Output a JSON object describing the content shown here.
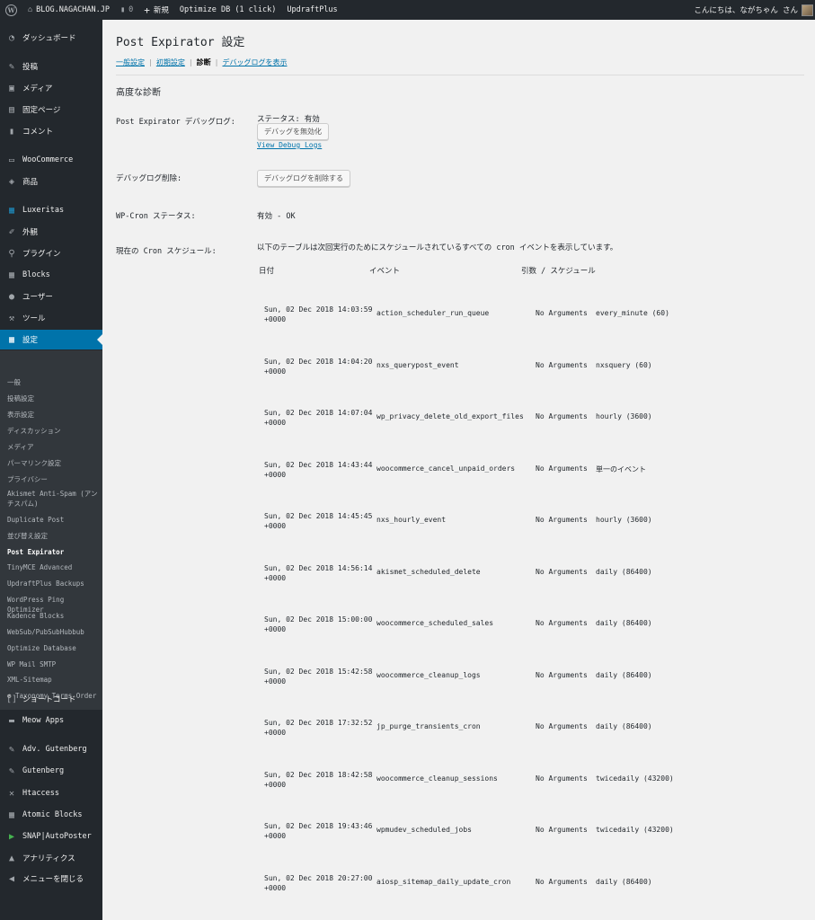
{
  "adminbar": {
    "site_name": "BLOG.NAGACHAN.JP",
    "comments_count": "0",
    "new_label": "新規",
    "optimize_label": "Optimize DB (1 click)",
    "updraft_label": "UpdraftPlus",
    "greeting": "こんにちは、ながちゃん さん"
  },
  "sidebar": {
    "items": [
      {
        "label": "ダッシュボード",
        "icon": "dashboard-icon"
      },
      {
        "label": "投稿",
        "icon": "pin-icon"
      },
      {
        "label": "メディア",
        "icon": "media-icon"
      },
      {
        "label": "固定ページ",
        "icon": "page-icon"
      },
      {
        "label": "コメント",
        "icon": "comment-icon"
      },
      {
        "label": "WooCommerce",
        "icon": "woocommerce-icon"
      },
      {
        "label": "商品",
        "icon": "product-icon"
      },
      {
        "label": "Luxeritas",
        "icon": "luxeritas-icon"
      },
      {
        "label": "外観",
        "icon": "brush-icon"
      },
      {
        "label": "プラグイン",
        "icon": "plugin-icon"
      },
      {
        "label": "Blocks",
        "icon": "blocks-icon"
      },
      {
        "label": "ユーザー",
        "icon": "user-icon"
      },
      {
        "label": "ツール",
        "icon": "wrench-icon"
      },
      {
        "label": "設定",
        "icon": "settings-icon"
      },
      {
        "label": "ショートコード",
        "icon": "shortcode-icon"
      },
      {
        "label": "Meow Apps",
        "icon": "meow-icon"
      },
      {
        "label": "Adv. Gutenberg",
        "icon": "pen-icon"
      },
      {
        "label": "Gutenberg",
        "icon": "pen-icon"
      },
      {
        "label": "Htaccess",
        "icon": "tools-icon"
      },
      {
        "label": "Atomic Blocks",
        "icon": "grid-icon"
      },
      {
        "label": "SNAP|AutoPoster",
        "icon": "snap-icon"
      },
      {
        "label": "アナリティクス",
        "icon": "analytics-icon"
      },
      {
        "label": "メニューを閉じる",
        "icon": "collapse-icon"
      }
    ],
    "submenu": [
      "一般",
      "投稿設定",
      "表示設定",
      "ディスカッション",
      "メディア",
      "パーマリンク設定",
      "プライバシー",
      "Akismet Anti-Spam (アンチスパム)",
      "Duplicate Post",
      "並び替え設定",
      "Post Expirator",
      "TinyMCE Advanced",
      "UpdraftPlus Backups",
      "WordPress Ping Optimizer",
      "Kadence Blocks",
      "WebSub/PubSubHubbub",
      "Optimize Database",
      "WP Mail SMTP",
      "XML-Sitemap",
      "Taxonomy Terms Order"
    ]
  },
  "page": {
    "title": "Post Expirator 設定",
    "tabs": [
      "一般設定",
      "初期設定",
      "診断",
      "デバッグログを表示"
    ],
    "section_title": "高度な診断",
    "debug_label": "Post Expirator デバッグログ:",
    "debug_status": "ステータス: 有効",
    "debug_disable_button": "デバッグを無効化",
    "view_debug_link": "View Debug Logs",
    "log_delete_label": "デバッグログ削除:",
    "log_delete_button": "デバッグログを削除する",
    "wpcron_label": "WP-Cron ステータス:",
    "wpcron_value": "有効 - OK",
    "cron_label": "現在の Cron スケジュール:",
    "cron_desc": "以下のテーブルは次回実行のためにスケジュールされているすべての cron イベントを表示しています。",
    "table_headers": {
      "date": "日付",
      "event": "イベント",
      "args": "引数 / スケジュール"
    }
  },
  "cron_rows": [
    {
      "date": "Sun, 02 Dec 2018 14:03:59",
      "tz": "+0000",
      "event": "action_scheduler_run_queue",
      "args": "No Arguments",
      "schedule": "every_minute (60)"
    },
    {
      "date": "Sun, 02 Dec 2018 14:04:20",
      "tz": "+0000",
      "event": "nxs_querypost_event",
      "args": "No Arguments",
      "schedule": "nxsquery (60)"
    },
    {
      "date": "Sun, 02 Dec 2018 14:07:04",
      "tz": "+0000",
      "event": "wp_privacy_delete_old_export_files",
      "args": "No Arguments",
      "schedule": "hourly (3600)"
    },
    {
      "date": "Sun, 02 Dec 2018 14:43:44",
      "tz": "+0000",
      "event": "woocommerce_cancel_unpaid_orders",
      "args": "No Arguments",
      "schedule": "単一のイベント"
    },
    {
      "date": "Sun, 02 Dec 2018 14:45:45",
      "tz": "+0000",
      "event": "nxs_hourly_event",
      "args": "No Arguments",
      "schedule": "hourly (3600)"
    },
    {
      "date": "Sun, 02 Dec 2018 14:56:14",
      "tz": "+0000",
      "event": "akismet_scheduled_delete",
      "args": "No Arguments",
      "schedule": "daily (86400)"
    },
    {
      "date": "Sun, 02 Dec 2018 15:00:00",
      "tz": "+0000",
      "event": "woocommerce_scheduled_sales",
      "args": "No Arguments",
      "schedule": "daily (86400)"
    },
    {
      "date": "Sun, 02 Dec 2018 15:42:58",
      "tz": "+0000",
      "event": "woocommerce_cleanup_logs",
      "args": "No Arguments",
      "schedule": "daily (86400)"
    },
    {
      "date": "Sun, 02 Dec 2018 17:32:52",
      "tz": "+0000",
      "event": "jp_purge_transients_cron",
      "args": "No Arguments",
      "schedule": "daily (86400)"
    },
    {
      "date": "Sun, 02 Dec 2018 18:42:58",
      "tz": "+0000",
      "event": "woocommerce_cleanup_sessions",
      "args": "No Arguments",
      "schedule": "twicedaily (43200)"
    },
    {
      "date": "Sun, 02 Dec 2018 19:43:46",
      "tz": "+0000",
      "event": "wpmudev_scheduled_jobs",
      "args": "No Arguments",
      "schedule": "twicedaily (43200)"
    },
    {
      "date": "Sun, 02 Dec 2018 20:27:00",
      "tz": "+0000",
      "event": "aiosp_sitemap_daily_update_cron",
      "args": "No Arguments",
      "schedule": "daily (86400)"
    }
  ]
}
